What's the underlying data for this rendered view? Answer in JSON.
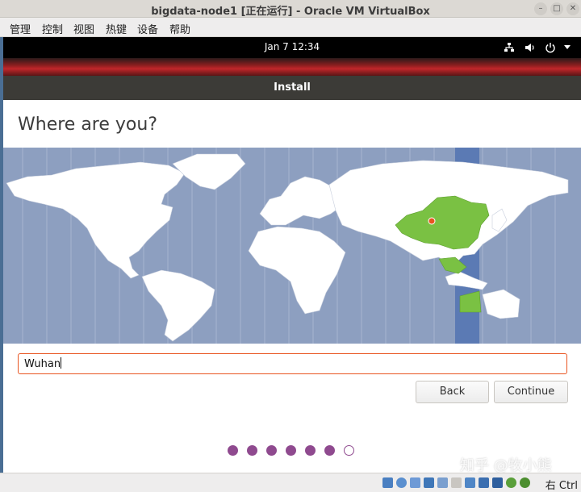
{
  "window": {
    "title": "bigdata-node1 [正在运行] - Oracle VM VirtualBox",
    "menu": [
      "管理",
      "控制",
      "视图",
      "热键",
      "设备",
      "帮助"
    ]
  },
  "guest_topbar": {
    "clock": "Jan 7  12:34",
    "icons": [
      "network-icon",
      "volume-icon",
      "power-icon",
      "chevron-down-icon"
    ]
  },
  "installer": {
    "header_title": "Install",
    "page_title": "Where are you?",
    "location_value": "Wuhan",
    "buttons": {
      "back": "Back",
      "continue": "Continue"
    },
    "progress": {
      "total_steps": 7,
      "completed_steps": 6
    }
  },
  "statusbar": {
    "host_key": "右 Ctrl"
  },
  "watermark": "知乎 @牧小熊",
  "colors": {
    "map_ocean": "#8d9fc0",
    "map_land": "#ffffff",
    "selected_zone": "#5b7ab4",
    "selected_region": "#7ac143",
    "accent_orange": "#e95420",
    "progress_purple": "#8f4a8f"
  }
}
